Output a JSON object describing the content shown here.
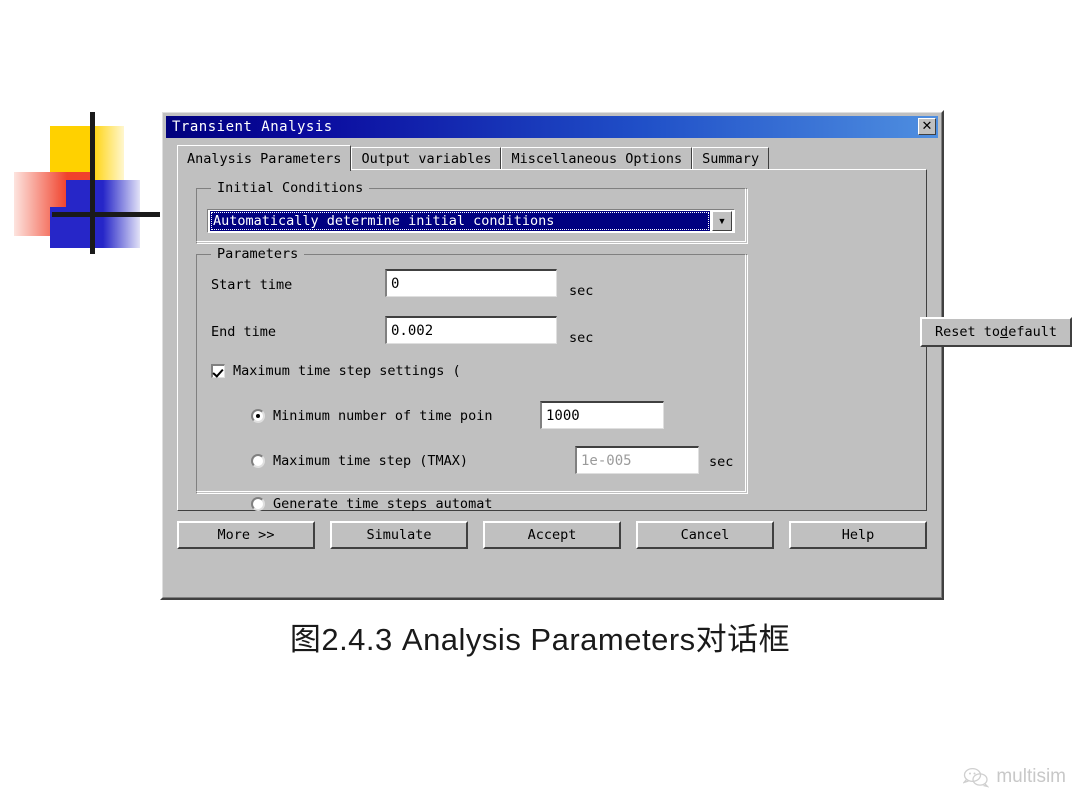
{
  "decor": {
    "logo_name": "colored-squares-crosshair-logo"
  },
  "dialog": {
    "title": "Transient Analysis",
    "close_label": "✕",
    "tabs": [
      {
        "label": "Analysis Parameters",
        "active": true
      },
      {
        "label": "Output variables",
        "active": false
      },
      {
        "label": "Miscellaneous Options",
        "active": false
      },
      {
        "label": "Summary",
        "active": false
      }
    ],
    "initial_conditions": {
      "group_title": "Initial Conditions",
      "selected_value": "Automatically determine initial conditions",
      "arrow_glyph": "▼"
    },
    "parameters": {
      "group_title": "Parameters",
      "start_time_label": "Start time",
      "start_time_value": "0",
      "start_time_unit": "sec",
      "end_time_label": "End time",
      "end_time_value": "0.002",
      "end_time_unit": "sec",
      "max_step_checkbox_label": "Maximum time step settings (",
      "max_step_checked": true,
      "min_points_label": "Minimum number of time poin",
      "min_points_value": "1000",
      "min_points_selected": true,
      "tmax_label": "Maximum time step (TMAX)",
      "tmax_value": "1e-005",
      "tmax_unit": "sec",
      "tmax_selected": false,
      "generate_label": "Generate time steps automat",
      "generate_selected": false
    },
    "reset_button": {
      "prefix": "Reset to ",
      "accel": "d",
      "suffix": "efault"
    },
    "buttons": [
      {
        "label": "More >>"
      },
      {
        "label": "Simulate"
      },
      {
        "label": "Accept"
      },
      {
        "label": "Cancel"
      },
      {
        "label": "Help"
      }
    ]
  },
  "caption": "图2.4.3  Analysis Parameters对话框",
  "watermark": {
    "text": "multisim",
    "icon": "wechat-speech-bubble-icon"
  },
  "colors": {
    "titlebar_start": "#00007d",
    "titlebar_end": "#4f8fe0",
    "dialog_face": "#c0c0c0",
    "selection_blue": "#000080"
  }
}
